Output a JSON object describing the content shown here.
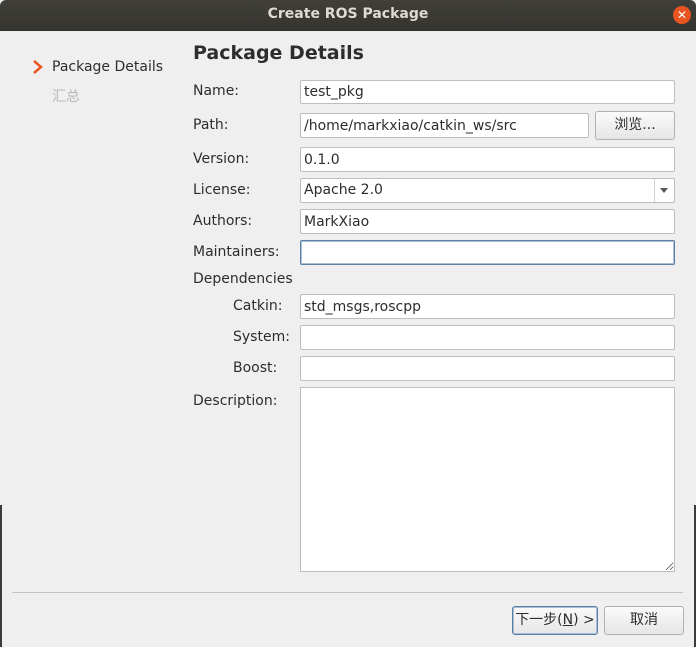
{
  "window": {
    "title": "Create ROS Package",
    "close_icon": "close-icon"
  },
  "sidebar": {
    "steps": [
      {
        "label": "Package Details",
        "active": true
      },
      {
        "label": "汇总",
        "active": false
      }
    ]
  },
  "page": {
    "heading": "Package Details"
  },
  "form": {
    "name": {
      "label": "Name:",
      "value": "test_pkg"
    },
    "path": {
      "label": "Path:",
      "value": "/home/markxiao/catkin_ws/src",
      "browse": "浏览..."
    },
    "version": {
      "label": "Version:",
      "value": "0.1.0"
    },
    "license": {
      "label": "License:",
      "value": "Apache 2.0"
    },
    "authors": {
      "label": "Authors:",
      "value": "MarkXiao"
    },
    "maintainers": {
      "label": "Maintainers:",
      "value": ""
    },
    "dependencies_heading": "Dependencies",
    "catkin": {
      "label": "Catkin:",
      "value": "std_msgs,roscpp"
    },
    "system": {
      "label": "System:",
      "value": ""
    },
    "boost": {
      "label": "Boost:",
      "value": ""
    },
    "description": {
      "label": "Description:",
      "value": ""
    }
  },
  "footer": {
    "next_button": "下一步(N) >",
    "next_button_pre": "下一步(",
    "next_button_mnemonic": "N",
    "next_button_post": ") >",
    "cancel_button": "取消"
  },
  "colors": {
    "accent": "#e95420",
    "titlebar": "#3c3b37"
  }
}
